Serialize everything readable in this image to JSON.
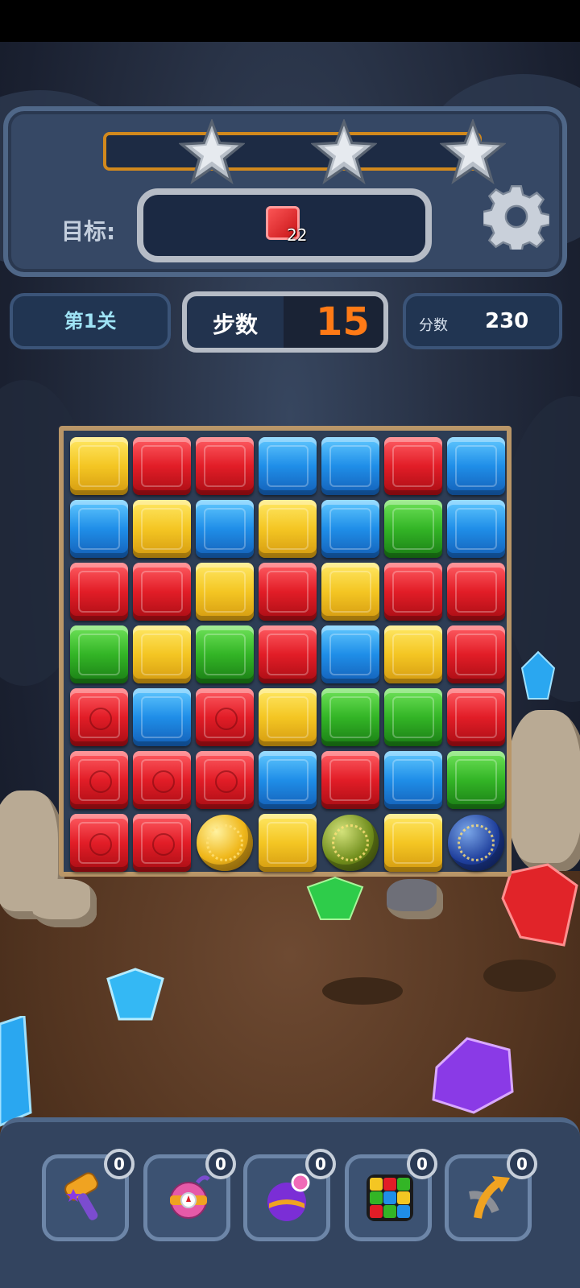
{
  "hud": {
    "target_label": "目标:",
    "target_count": "22",
    "level_label": "第1关",
    "moves_label": "步数",
    "moves_value": "15",
    "score_label": "分数",
    "score_value": "230",
    "progress": 0,
    "stars": 3
  },
  "board": {
    "rows": [
      [
        "yellow",
        "red",
        "red",
        "blue",
        "blue",
        "red",
        "blue"
      ],
      [
        "blue",
        "yellow",
        "blue",
        "yellow",
        "blue",
        "green",
        "blue"
      ],
      [
        "red",
        "red",
        "yellow",
        "red",
        "yellow",
        "red",
        "red"
      ],
      [
        "green",
        "yellow",
        "green",
        "red",
        "blue",
        "yellow",
        "red"
      ],
      [
        "red-bomb",
        "blue",
        "red-bomb",
        "yellow",
        "green",
        "green",
        "red"
      ],
      [
        "red-bomb",
        "red-bomb",
        "red-bomb",
        "blue",
        "red",
        "blue",
        "green"
      ],
      [
        "red-bomb",
        "red-bomb",
        "ball-gold",
        "yellow",
        "ball-olive",
        "yellow",
        "ball-navy"
      ]
    ]
  },
  "boosters": [
    {
      "name": "hammer",
      "count": "0"
    },
    {
      "name": "bomb",
      "count": "0"
    },
    {
      "name": "ball",
      "count": "0"
    },
    {
      "name": "rubik-cube",
      "count": "0"
    },
    {
      "name": "swap",
      "count": "0"
    }
  ],
  "colors": {
    "accent_orange": "#ff7a16",
    "panel": "#364865",
    "progress_border": "#d2891d"
  }
}
